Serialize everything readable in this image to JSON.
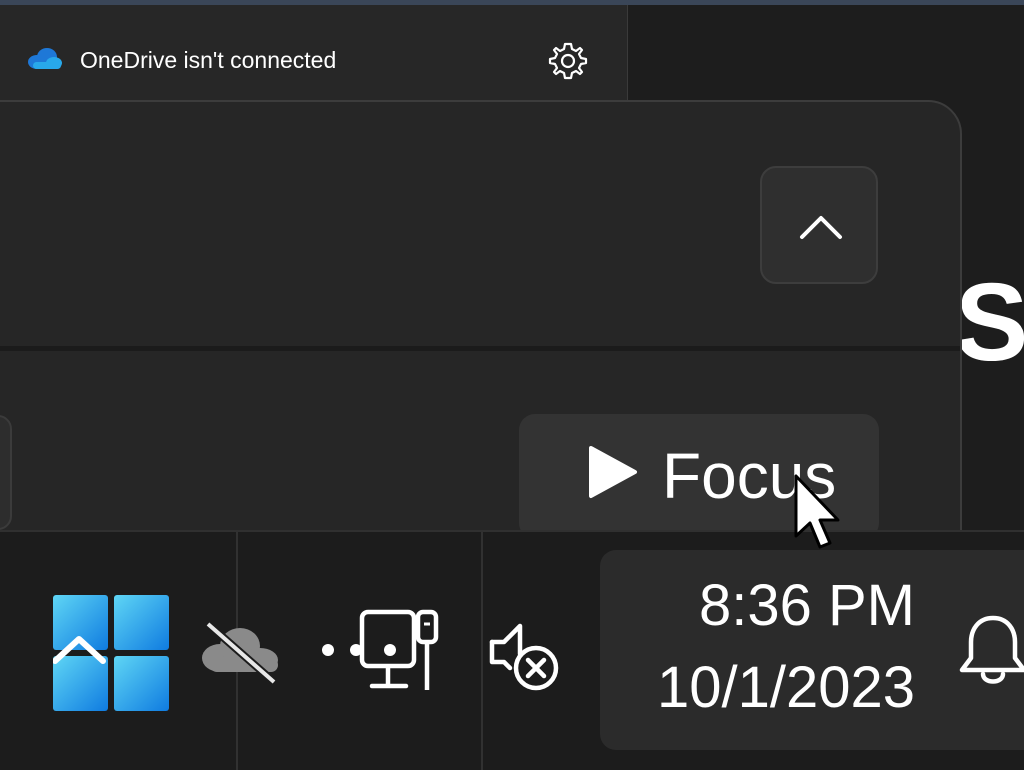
{
  "onedrive": {
    "status_text": "OneDrive isn't connected",
    "cloud_icon": "onedrive-cloud-icon",
    "settings_icon": "gear-icon",
    "accent_color": "#1e78d7"
  },
  "background": {
    "partial_text": "S"
  },
  "clock_flyout": {
    "collapse_icon": "chevron-up-icon",
    "focus_button": {
      "label": "Focus",
      "icon": "play-icon"
    }
  },
  "taskbar": {
    "start_icon": "windows-start-icon",
    "tray": {
      "onedrive_icon": "onedrive-offline-icon",
      "network_icon": "ethernet-disconnected-icon",
      "volume_icon": "volume-muted-icon"
    },
    "clock": {
      "time": "8:36 PM",
      "date": "10/1/2023"
    },
    "notifications_icon": "bell-icon"
  },
  "colors": {
    "start_gradient_top": "#5fd6f5",
    "start_gradient_bottom": "#0f7be0"
  }
}
